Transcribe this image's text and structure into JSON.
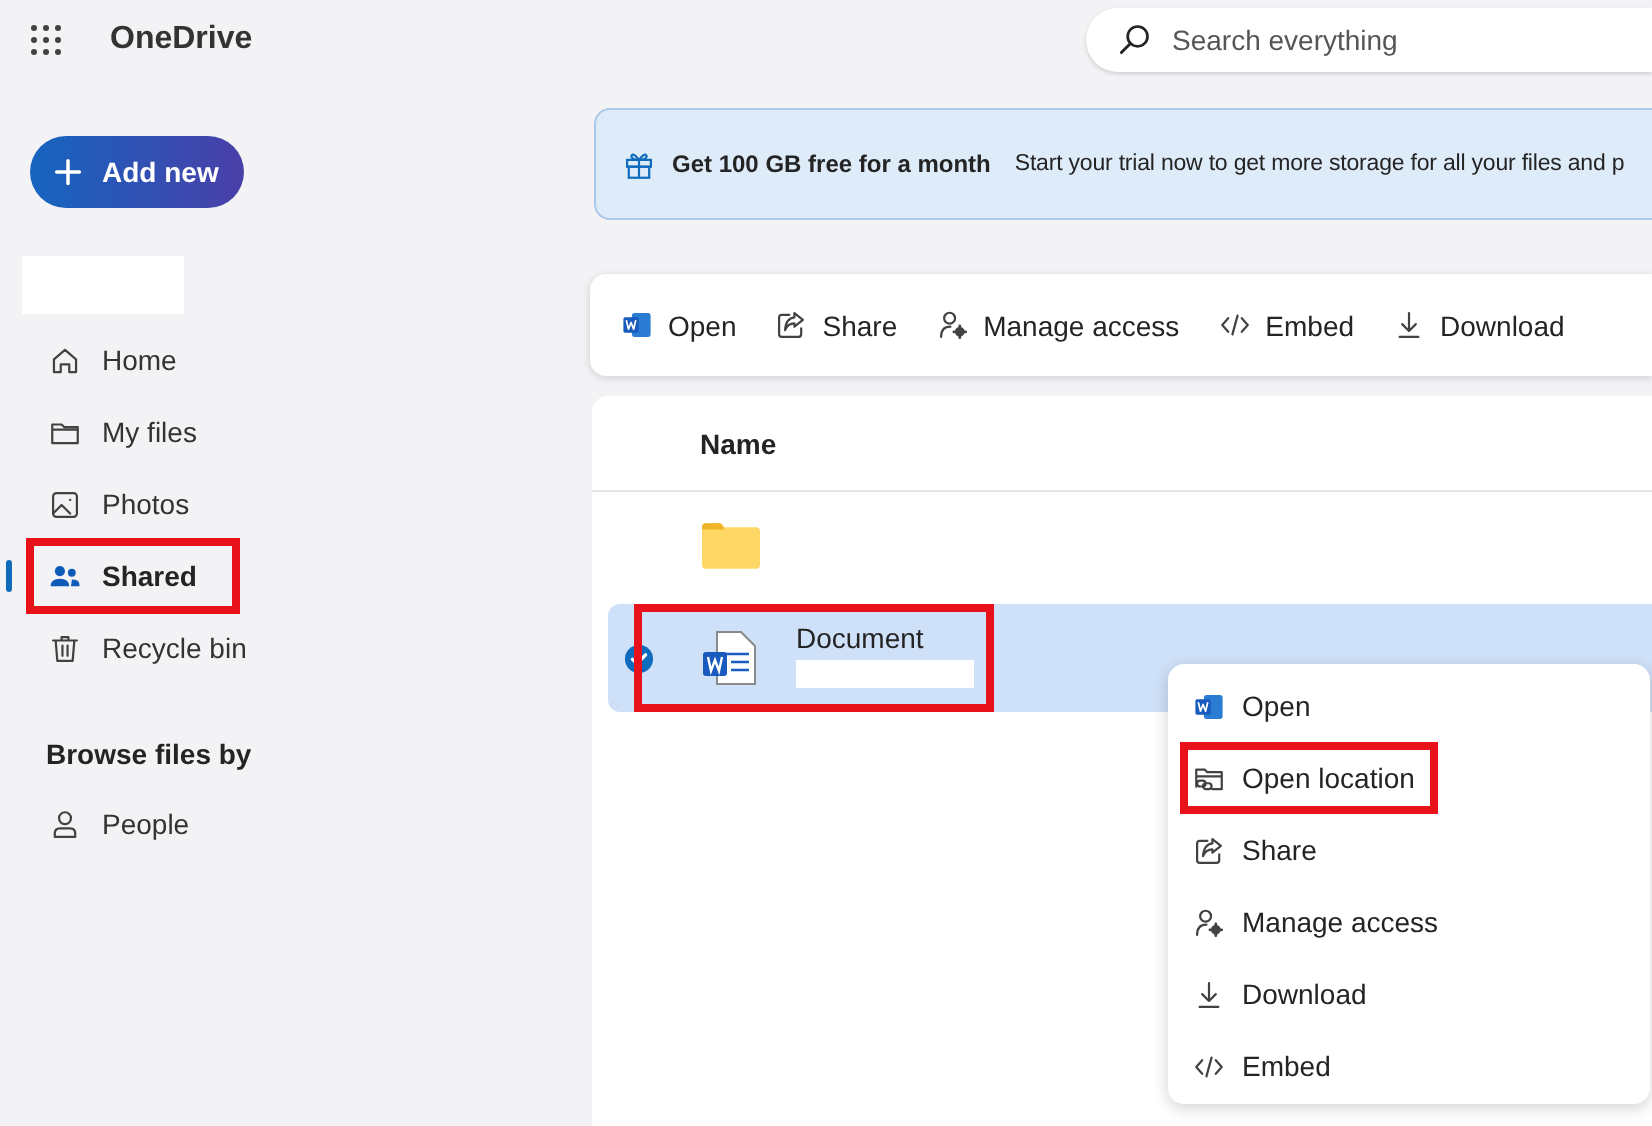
{
  "app": {
    "name": "OneDrive"
  },
  "search": {
    "placeholder": "Search everything"
  },
  "add_button": "Add new",
  "nav": [
    {
      "label": "Home",
      "selected": false,
      "highlighted": false
    },
    {
      "label": "My files",
      "selected": false,
      "highlighted": false
    },
    {
      "label": "Photos",
      "selected": false,
      "highlighted": false
    },
    {
      "label": "Shared",
      "selected": true,
      "highlighted": true
    },
    {
      "label": "Recycle bin",
      "selected": false,
      "highlighted": false
    }
  ],
  "browse": {
    "heading": "Browse files by",
    "items": [
      {
        "label": "People"
      }
    ]
  },
  "banner": {
    "title": "Get 100 GB free for a month",
    "text": "Start your trial now to get more storage for all your files and p"
  },
  "toolbar": [
    "Open",
    "Share",
    "Manage access",
    "Embed",
    "Download"
  ],
  "table": {
    "columns": [
      "Name"
    ],
    "rows": [
      {
        "kind": "folder",
        "selected": false,
        "highlighted": false
      },
      {
        "kind": "word",
        "name": "Document",
        "selected": true,
        "highlighted": true
      }
    ]
  },
  "context_menu": [
    {
      "label": "Open",
      "highlighted": false
    },
    {
      "label": "Open location",
      "highlighted": true
    },
    {
      "label": "Share",
      "highlighted": false
    },
    {
      "label": "Manage access",
      "highlighted": false
    },
    {
      "label": "Download",
      "highlighted": false
    },
    {
      "label": "Embed",
      "highlighted": false
    }
  ]
}
